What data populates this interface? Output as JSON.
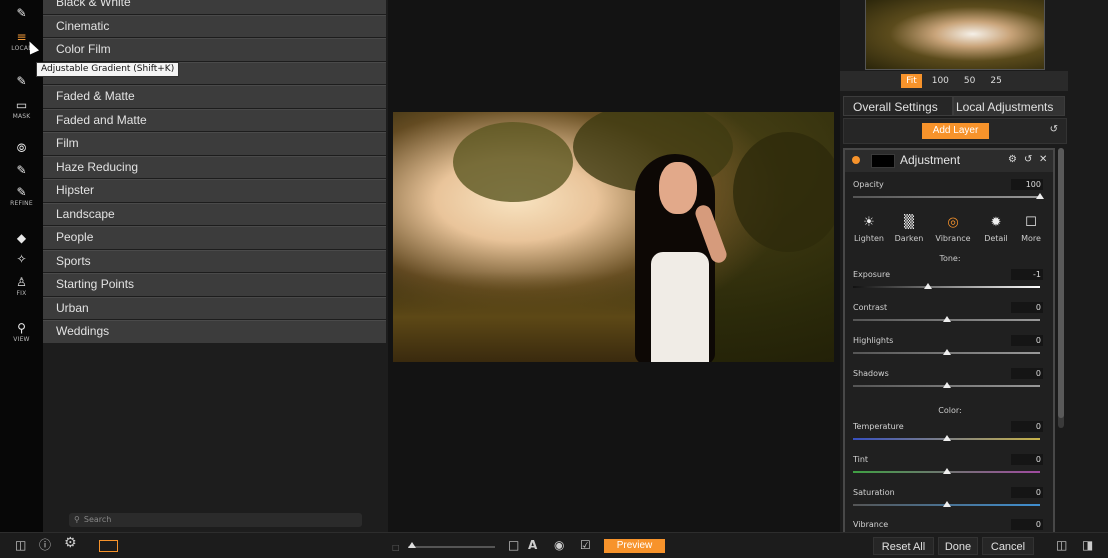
{
  "toolbar": {
    "groups": [
      {
        "label": "LOCAL"
      },
      {
        "label": "MASK"
      },
      {
        "label": "REFINE"
      },
      {
        "label": "FIX"
      },
      {
        "label": "VIEW"
      }
    ],
    "tooltip": "Adjustable Gradient (Shift+K)"
  },
  "categories": {
    "items": [
      "Black & White",
      "Cinematic",
      "Color Film",
      "",
      "Faded & Matte",
      "Faded and Matte",
      "Film",
      "Haze Reducing",
      "Hipster",
      "Landscape",
      "People",
      "Sports",
      "Starting Points",
      "Urban",
      "Weddings"
    ],
    "search_placeholder": "Search"
  },
  "zoom": {
    "options": [
      "Fit",
      "100",
      "50",
      "25"
    ],
    "active": "Fit"
  },
  "tabs": [
    "Overall Settings",
    "Local Adjustments"
  ],
  "add_layer_label": "Add Layer",
  "adjustment": {
    "title": "Adjustment",
    "opacity": {
      "label": "Opacity",
      "value": "100",
      "level": 1.0
    },
    "presets": [
      "Lighten",
      "Darken",
      "Vibrance",
      "Detail",
      "More"
    ],
    "tone_label": "Tone:",
    "tone": [
      {
        "key": "exposure",
        "label": "Exposure",
        "value": "-1",
        "level": 0.4
      },
      {
        "key": "contrast",
        "label": "Contrast",
        "value": "0",
        "level": 0.5
      },
      {
        "key": "highlights",
        "label": "Highlights",
        "value": "0",
        "level": 0.5
      },
      {
        "key": "shadows",
        "label": "Shadows",
        "value": "0",
        "level": 0.5
      }
    ],
    "color_label": "Color:",
    "color": [
      {
        "key": "temperature",
        "label": "Temperature",
        "value": "0",
        "level": 0.5
      },
      {
        "key": "tint",
        "label": "Tint",
        "value": "0",
        "level": 0.5
      },
      {
        "key": "saturation",
        "label": "Saturation",
        "value": "0",
        "level": 0.5
      },
      {
        "key": "vibrance",
        "label": "Vibrance",
        "value": "0",
        "level": 0.5
      }
    ]
  },
  "bottom": {
    "preview_label": "Preview",
    "reset_all_label": "Reset All",
    "done_label": "Done",
    "cancel_label": "Cancel"
  },
  "colors": {
    "accent": "#f7932b"
  }
}
